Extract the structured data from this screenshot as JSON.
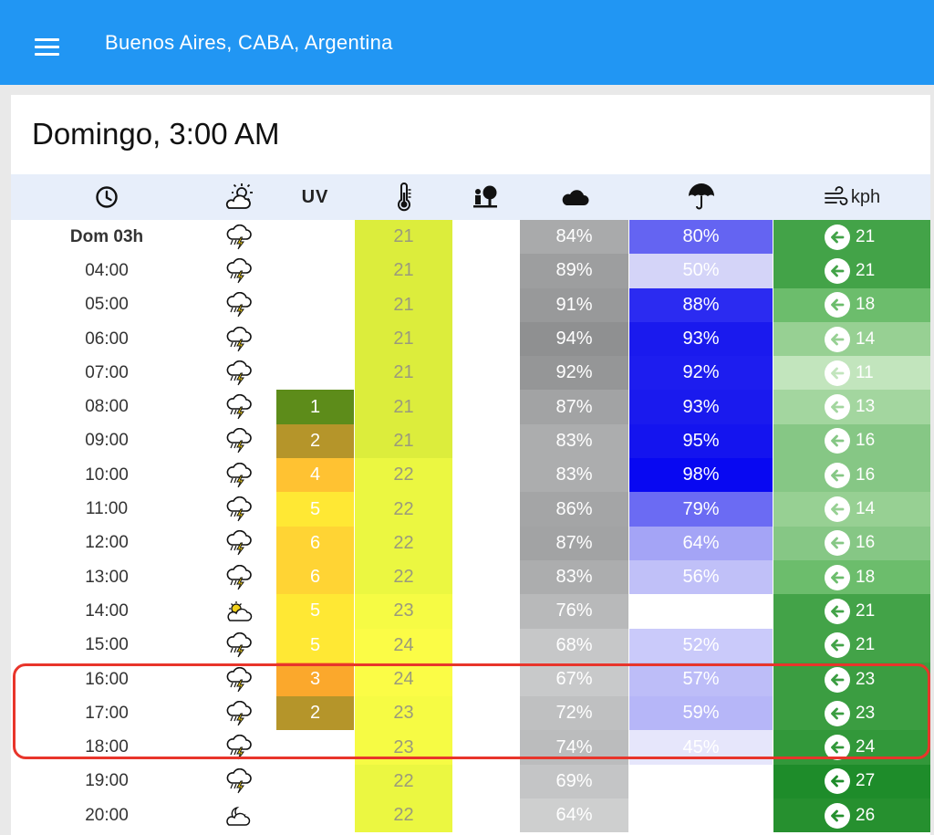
{
  "header": {
    "location": "Buenos Aires, CABA, Argentina",
    "menu_icon": "hamburger-menu-icon"
  },
  "card": {
    "title": "Domingo, 3:00 AM"
  },
  "columns": {
    "time_icon": "clock-icon",
    "sky_icon": "partly-sunny-icon",
    "uv_label": "UV",
    "temp_icon": "thermometer-icon",
    "feel_icon": "person-tree-icon",
    "cloud_icon": "cloud-icon",
    "rain_icon": "umbrella-icon",
    "wind_icon": "wind-icon",
    "wind_unit": "kph"
  },
  "colors": {
    "topbar": "#2196f3",
    "highlight": "#e8352b"
  },
  "rows": [
    {
      "time": "Dom 03h",
      "bold": true,
      "icon": "thunderstorm",
      "uv": "",
      "uv_color": "",
      "temp": "21",
      "temp_color": "#dced3c",
      "cloud": "84%",
      "cloud_color": "#a9aaab",
      "rain": "80%",
      "rain_color": "#6464f2",
      "wind": "21",
      "wind_color": "#43a348"
    },
    {
      "time": "04:00",
      "bold": false,
      "icon": "thunderstorm",
      "uv": "",
      "uv_color": "",
      "temp": "21",
      "temp_color": "#dced3c",
      "cloud": "89%",
      "cloud_color": "#9d9e9f",
      "rain": "50%",
      "rain_color": "#d4d4f8",
      "wind": "21",
      "wind_color": "#43a348"
    },
    {
      "time": "05:00",
      "bold": false,
      "icon": "thunderstorm",
      "uv": "",
      "uv_color": "",
      "temp": "21",
      "temp_color": "#dced3c",
      "cloud": "91%",
      "cloud_color": "#98999a",
      "rain": "88%",
      "rain_color": "#2b2bf1",
      "wind": "18",
      "wind_color": "#6cbd6c"
    },
    {
      "time": "06:00",
      "bold": false,
      "icon": "thunderstorm",
      "uv": "",
      "uv_color": "",
      "temp": "21",
      "temp_color": "#dced3c",
      "cloud": "94%",
      "cloud_color": "#8f9091",
      "rain": "93%",
      "rain_color": "#1a1aee",
      "wind": "14",
      "wind_color": "#97d093"
    },
    {
      "time": "07:00",
      "bold": false,
      "icon": "thunderstorm",
      "uv": "",
      "uv_color": "",
      "temp": "21",
      "temp_color": "#dced3c",
      "cloud": "92%",
      "cloud_color": "#959697",
      "rain": "92%",
      "rain_color": "#1d1def",
      "wind": "11",
      "wind_color": "#c2e5bd"
    },
    {
      "time": "08:00",
      "bold": false,
      "icon": "thunderstorm",
      "uv": "1",
      "uv_color": "#5d8c1a",
      "temp": "21",
      "temp_color": "#dced3c",
      "cloud": "87%",
      "cloud_color": "#a2a3a4",
      "rain": "93%",
      "rain_color": "#1a1aee",
      "wind": "13",
      "wind_color": "#a3d69f"
    },
    {
      "time": "09:00",
      "bold": false,
      "icon": "thunderstorm",
      "uv": "2",
      "uv_color": "#b5952a",
      "temp": "21",
      "temp_color": "#dced3c",
      "cloud": "83%",
      "cloud_color": "#acadae",
      "rain": "95%",
      "rain_color": "#1414ef",
      "wind": "16",
      "wind_color": "#86c785"
    },
    {
      "time": "10:00",
      "bold": false,
      "icon": "thunderstorm",
      "uv": "4",
      "uv_color": "#ffc232",
      "temp": "22",
      "temp_color": "#ebf741",
      "cloud": "83%",
      "cloud_color": "#acadae",
      "rain": "98%",
      "rain_color": "#0808f2",
      "wind": "16",
      "wind_color": "#86c785"
    },
    {
      "time": "11:00",
      "bold": false,
      "icon": "thunderstorm",
      "uv": "5",
      "uv_color": "#ffe834",
      "temp": "22",
      "temp_color": "#ebf741",
      "cloud": "86%",
      "cloud_color": "#a4a5a6",
      "rain": "79%",
      "rain_color": "#6b6bf3",
      "wind": "14",
      "wind_color": "#97d093"
    },
    {
      "time": "12:00",
      "bold": false,
      "icon": "thunderstorm",
      "uv": "6",
      "uv_color": "#ffd434",
      "temp": "22",
      "temp_color": "#ebf741",
      "cloud": "87%",
      "cloud_color": "#a2a3a4",
      "rain": "64%",
      "rain_color": "#a4a4f6",
      "wind": "16",
      "wind_color": "#86c785"
    },
    {
      "time": "13:00",
      "bold": false,
      "icon": "thunderstorm",
      "uv": "6",
      "uv_color": "#ffd434",
      "temp": "22",
      "temp_color": "#ebf741",
      "cloud": "83%",
      "cloud_color": "#acadae",
      "rain": "56%",
      "rain_color": "#c0c0f8",
      "wind": "18",
      "wind_color": "#6cbd6c"
    },
    {
      "time": "14:00",
      "bold": false,
      "icon": "partly-cloudy",
      "uv": "5",
      "uv_color": "#ffe834",
      "temp": "23",
      "temp_color": "#f6fb44",
      "cloud": "76%",
      "cloud_color": "#b8b9ba",
      "rain": "",
      "rain_color": "",
      "wind": "21",
      "wind_color": "#43a348"
    },
    {
      "time": "15:00",
      "bold": false,
      "icon": "thunderstorm",
      "uv": "5",
      "uv_color": "#ffe834",
      "temp": "24",
      "temp_color": "#fbfc46",
      "cloud": "68%",
      "cloud_color": "#c6c7c8",
      "rain": "52%",
      "rain_color": "#cacafa",
      "wind": "21",
      "wind_color": "#43a348"
    },
    {
      "time": "16:00",
      "bold": false,
      "icon": "thunderstorm",
      "uv": "3",
      "uv_color": "#fba82c",
      "temp": "24",
      "temp_color": "#fbfc46",
      "cloud": "67%",
      "cloud_color": "#c8c9ca",
      "rain": "57%",
      "rain_color": "#bdbdf8",
      "wind": "23",
      "wind_color": "#3b9d41"
    },
    {
      "time": "17:00",
      "bold": false,
      "icon": "thunderstorm",
      "uv": "2",
      "uv_color": "#b5952a",
      "temp": "23",
      "temp_color": "#f6fb44",
      "cloud": "72%",
      "cloud_color": "#bfc0c1",
      "rain": "59%",
      "rain_color": "#b6b6f8",
      "wind": "23",
      "wind_color": "#3b9d41"
    },
    {
      "time": "18:00",
      "bold": false,
      "icon": "thunderstorm",
      "uv": "",
      "uv_color": "",
      "temp": "23",
      "temp_color": "#f6fb44",
      "cloud": "74%",
      "cloud_color": "#bbbcbd",
      "rain": "45%",
      "rain_color": "#e6e6fb",
      "wind": "24",
      "wind_color": "#32983a"
    },
    {
      "time": "19:00",
      "bold": false,
      "icon": "thunderstorm",
      "uv": "",
      "uv_color": "",
      "temp": "22",
      "temp_color": "#ebf741",
      "cloud": "69%",
      "cloud_color": "#c4c5c6",
      "rain": "",
      "rain_color": "",
      "wind": "27",
      "wind_color": "#1e8c2a"
    },
    {
      "time": "20:00",
      "bold": false,
      "icon": "night-cloud",
      "uv": "",
      "uv_color": "",
      "temp": "22",
      "temp_color": "#ebf741",
      "cloud": "64%",
      "cloud_color": "#cecfcf",
      "rain": "",
      "rain_color": "",
      "wind": "26",
      "wind_color": "#26902f"
    }
  ]
}
